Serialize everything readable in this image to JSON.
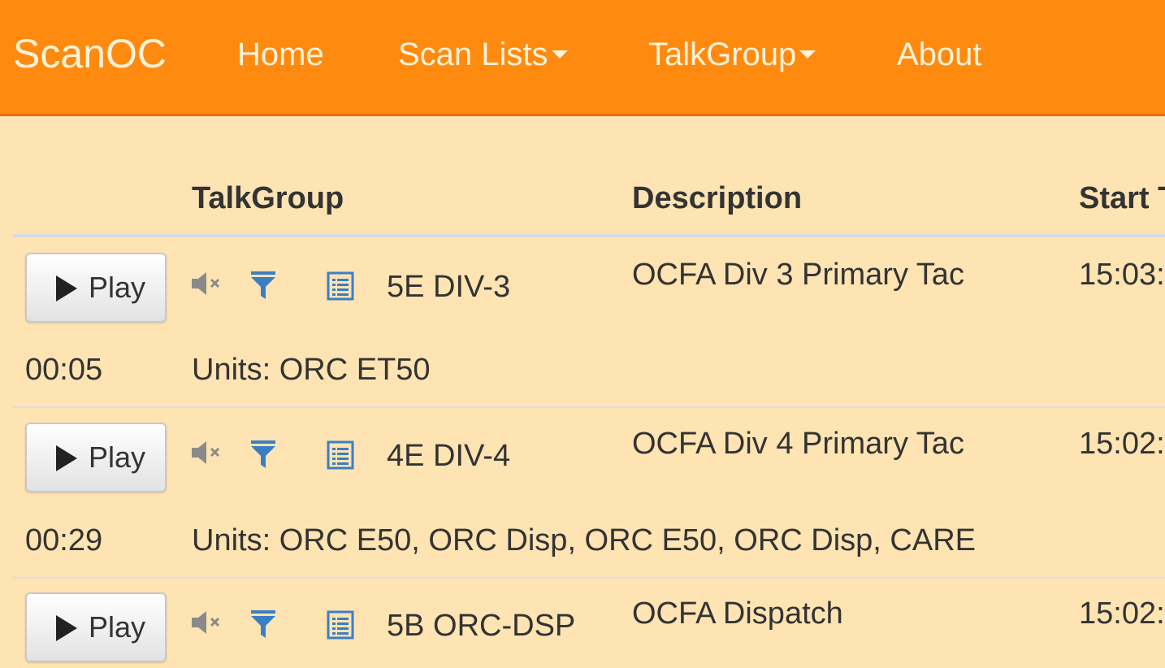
{
  "brand": "ScanOC",
  "nav": {
    "home": "Home",
    "scan_lists": "Scan Lists",
    "talkgroup": "TalkGroup",
    "about": "About"
  },
  "table": {
    "headers": {
      "talkgroup": "TalkGroup",
      "description": "Description",
      "start": "Start T"
    },
    "rows": [
      {
        "play_label": "Play",
        "talkgroup": "5E DIV-3",
        "description": "OCFA Div 3 Primary Tac",
        "start_time": "15:03:",
        "duration": "00:05",
        "units": "Units: ORC ET50"
      },
      {
        "play_label": "Play",
        "talkgroup": "4E DIV-4",
        "description": "OCFA Div 4 Primary Tac",
        "start_time": "15:02:",
        "duration": "00:29",
        "units": "Units: ORC E50, ORC Disp, ORC E50, ORC Disp, CARE"
      },
      {
        "play_label": "Play",
        "talkgroup": "5B ORC-DSP",
        "description": "OCFA Dispatch",
        "start_time": "15:02:",
        "duration": "",
        "units": ""
      }
    ]
  },
  "colors": {
    "navbar": "#ff8a10",
    "background": "#ffe4b3",
    "icon_blue": "#3a7fc4",
    "icon_gray": "#8a8a8a"
  },
  "icons": [
    "mute-icon",
    "filter-icon",
    "list-icon",
    "play-icon",
    "caret-down-icon"
  ]
}
